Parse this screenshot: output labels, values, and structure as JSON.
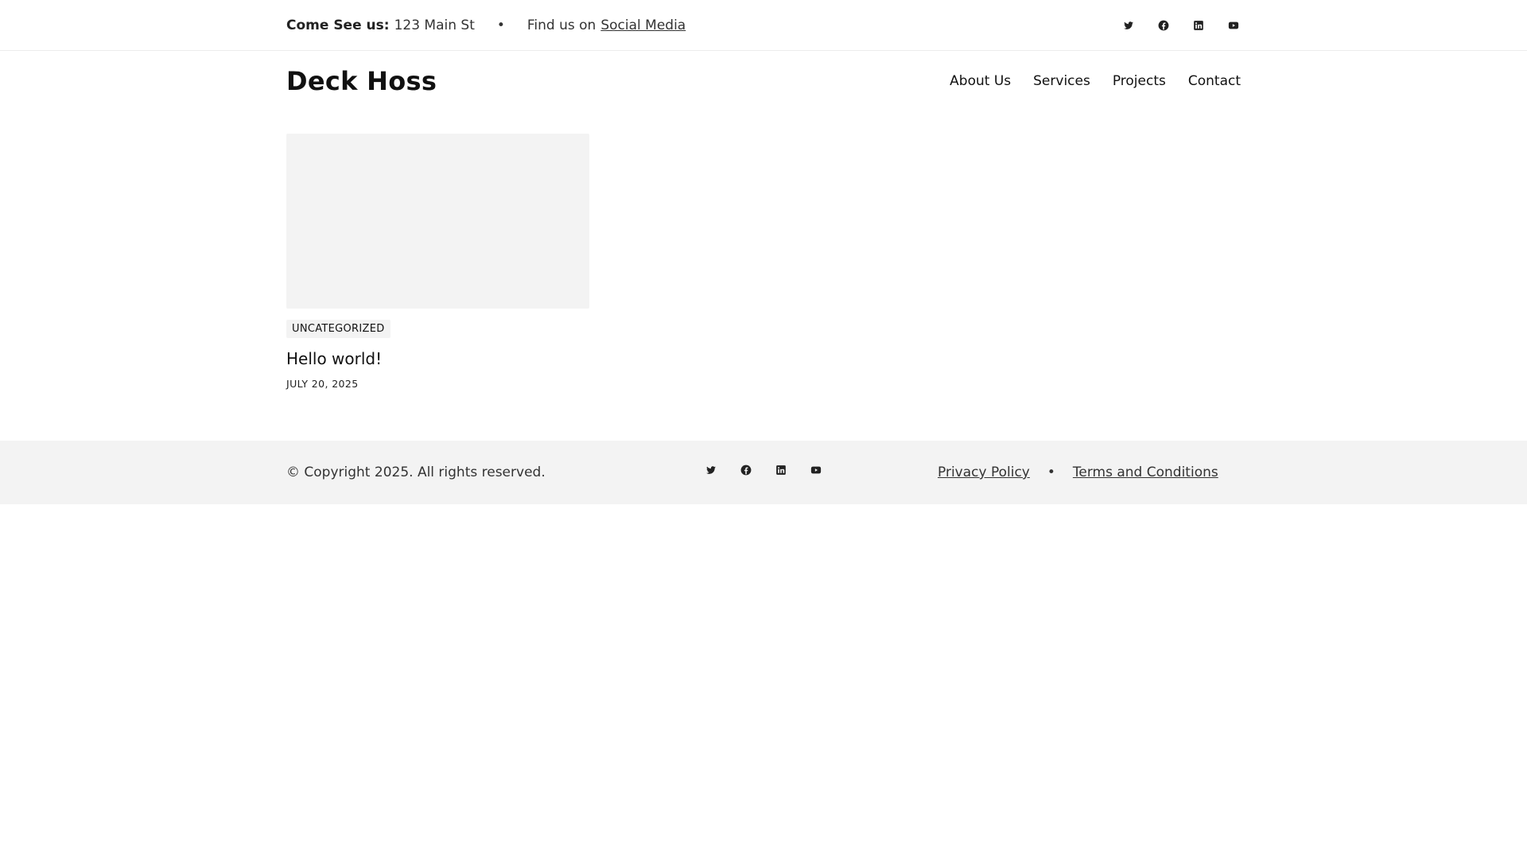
{
  "topbar": {
    "address_label": "Come See us:",
    "address_value": "123 Main St",
    "separator": "•",
    "social_prefix": "Find us on",
    "social_link": "Social Media",
    "social_icons": [
      "twitter-icon",
      "facebook-icon",
      "linkedin-icon",
      "youtube-icon"
    ]
  },
  "header": {
    "site_title": "Deck Hoss",
    "nav": [
      "About Us",
      "Services",
      "Projects",
      "Contact"
    ]
  },
  "posts": [
    {
      "category": "UNCATEGORIZED",
      "title": "Hello world!",
      "date": "JULY 20, 2025"
    }
  ],
  "footer": {
    "copyright": "© Copyright 2025. All rights reserved.",
    "social_icons": [
      "twitter-icon",
      "facebook-icon",
      "linkedin-icon",
      "youtube-icon"
    ],
    "links": [
      "Privacy Policy",
      "Terms and Conditions"
    ],
    "separator": "•"
  },
  "colors": {
    "text": "#111111",
    "muted_text": "#333333",
    "footer_bg": "#f3f3f3",
    "thumb_bg": "#f3f3f3"
  }
}
